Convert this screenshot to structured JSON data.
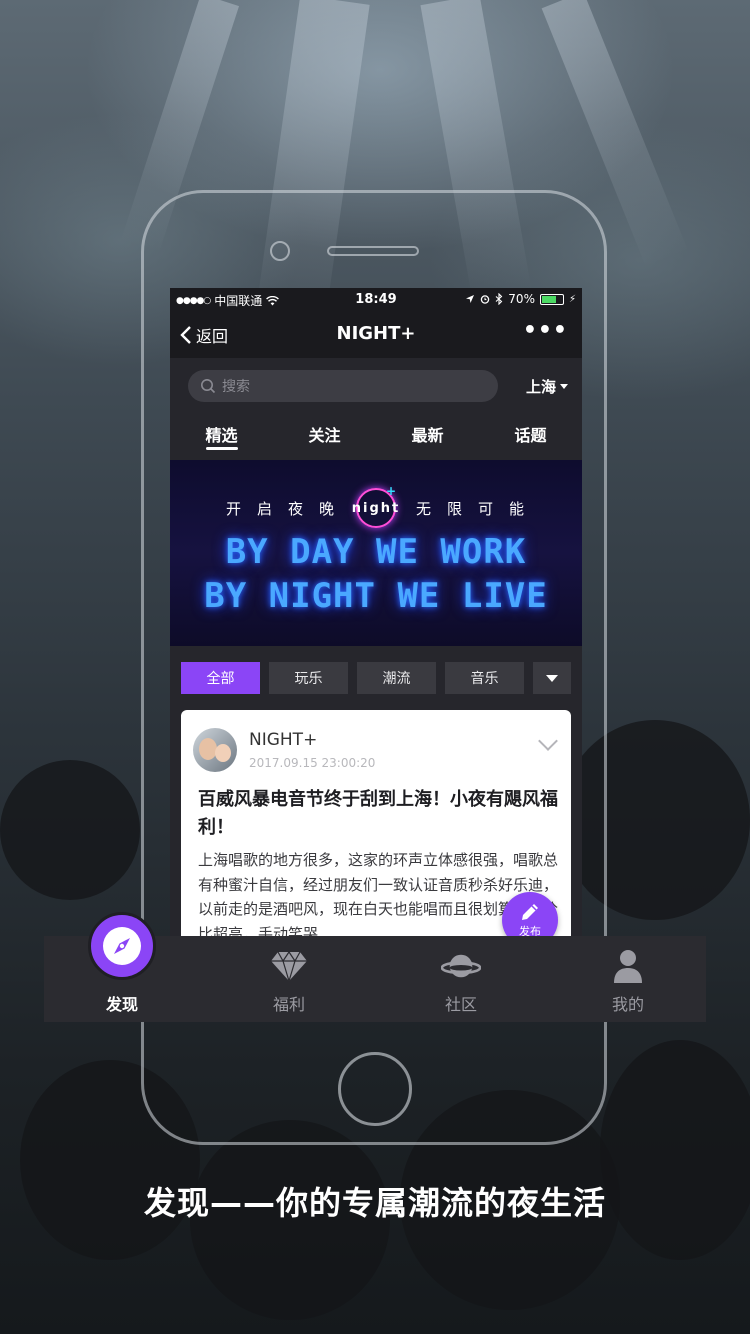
{
  "status_bar": {
    "signal": "●●●●○",
    "carrier": "中国联通",
    "time": "18:49",
    "battery": "70%",
    "battery_level": 0.7
  },
  "nav": {
    "back_label": "返回",
    "title": "NIGHT+",
    "more_icon": "more-dots-icon"
  },
  "search": {
    "placeholder": "搜索",
    "city": "上海"
  },
  "tabs": [
    "精选",
    "关注",
    "最新",
    "话题"
  ],
  "active_tab": "精选",
  "banner": {
    "left_words": [
      "开",
      "启",
      "夜",
      "晚"
    ],
    "logo_text": "night",
    "logo_plus": "+",
    "right_words": [
      "无",
      "限",
      "可",
      "能"
    ],
    "line1": "BY DAY WE WORK",
    "line2": "BY NIGHT WE LIVE"
  },
  "chips": [
    "全部",
    "玩乐",
    "潮流",
    "音乐"
  ],
  "active_chip": "全部",
  "post": {
    "author": "NIGHT+",
    "date": "2017.09.15  23:00:20",
    "title": "百威风暴电音节终于刮到上海！小夜有飓风福利！",
    "body": "上海唱歌的地方很多，这家的环声立体感很强，唱歌总有种蜜汁自信，经过朋友们一致认证音质秒杀好乐迪，以前走的是酒吧风，现在白天也能唱而且很划算，性价比超高，手动笑哭"
  },
  "fab": {
    "label": "发布",
    "icon": "pencil-icon"
  },
  "tabbar": [
    {
      "label": "发现",
      "icon": "compass-icon",
      "active": true
    },
    {
      "label": "福利",
      "icon": "diamond-icon",
      "active": false
    },
    {
      "label": "社区",
      "icon": "planet-icon",
      "active": false
    },
    {
      "label": "我的",
      "icon": "person-icon",
      "active": false
    }
  ],
  "tagline": "发现——你的专属潮流的夜生活",
  "colors": {
    "accent": "#8b45f6",
    "screen_bg": "#26262c",
    "bar_bg": "#1a1a1e",
    "neon_blue": "#4aa8ff"
  }
}
